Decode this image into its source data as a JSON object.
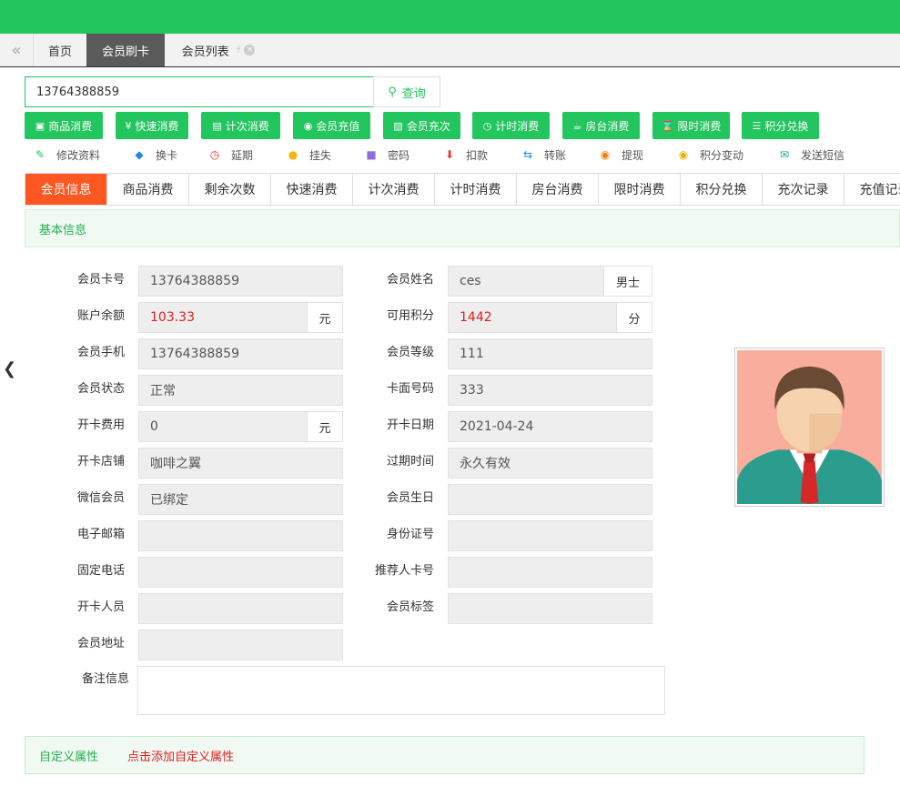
{
  "tabs": [
    {
      "label": "首页"
    },
    {
      "label": "会员刷卡"
    },
    {
      "label": "会员列表"
    }
  ],
  "search": {
    "value": "13764388859",
    "button_label": "查询"
  },
  "actions": [
    {
      "label": "商品消费",
      "icon": "bag-icon"
    },
    {
      "label": "快速消费",
      "icon": "yen-icon"
    },
    {
      "label": "计次消费",
      "icon": "card-icon"
    },
    {
      "label": "会员充值",
      "icon": "coin-icon"
    },
    {
      "label": "会员充次",
      "icon": "inbox-icon"
    },
    {
      "label": "计时消费",
      "icon": "clock-icon"
    },
    {
      "label": "房台消费",
      "icon": "cup-icon"
    },
    {
      "label": "限时消费",
      "icon": "hourglass-icon"
    },
    {
      "label": "积分兑换",
      "icon": "database-icon"
    }
  ],
  "tools": [
    {
      "label": "修改资料",
      "icon": "edit-icon",
      "color": "#22c55e"
    },
    {
      "label": "换卡",
      "icon": "tag-icon",
      "color": "#1e88e5"
    },
    {
      "label": "延期",
      "icon": "clock-icon",
      "color": "#e53935"
    },
    {
      "label": "挂失",
      "icon": "warning-icon",
      "color": "#f5b50a"
    },
    {
      "label": "密码",
      "icon": "lock-icon",
      "color": "#8e6fd6"
    },
    {
      "label": "扣款",
      "icon": "down-arrow-icon",
      "color": "#e53935"
    },
    {
      "label": "转账",
      "icon": "transfer-icon",
      "color": "#1e88e5"
    },
    {
      "label": "提现",
      "icon": "yen-circle-icon",
      "color": "#f57c00"
    },
    {
      "label": "积分变动",
      "icon": "coins-icon",
      "color": "#e8b100"
    },
    {
      "label": "发送短信",
      "icon": "message-icon",
      "color": "#26a69a"
    }
  ],
  "subtabs": [
    "会员信息",
    "商品消费",
    "剩余次数",
    "快速消费",
    "计次消费",
    "计时消费",
    "房台消费",
    "限时消费",
    "积分兑换",
    "充次记录",
    "充值记录"
  ],
  "section_title": "基本信息",
  "fields": {
    "card_no": {
      "label": "会员卡号",
      "value": "13764388859"
    },
    "name": {
      "label": "会员姓名",
      "value": "ces",
      "suffix": "男士"
    },
    "balance": {
      "label": "账户余额",
      "value": "103.33",
      "suffix": "元"
    },
    "points": {
      "label": "可用积分",
      "value": "1442",
      "suffix": "分"
    },
    "phone": {
      "label": "会员手机",
      "value": "13764388859"
    },
    "level": {
      "label": "会员等级",
      "value": "111"
    },
    "status": {
      "label": "会员状态",
      "value": "正常"
    },
    "face_no": {
      "label": "卡面号码",
      "value": "333"
    },
    "fee": {
      "label": "开卡费用",
      "value": "0",
      "suffix": "元"
    },
    "open_date": {
      "label": "开卡日期",
      "value": "2021-04-24"
    },
    "store": {
      "label": "开卡店铺",
      "value": "咖啡之翼"
    },
    "expire": {
      "label": "过期时间",
      "value": "永久有效"
    },
    "wechat": {
      "label": "微信会员",
      "value": "已绑定"
    },
    "birthday": {
      "label": "会员生日",
      "value": ""
    },
    "email": {
      "label": "电子邮箱",
      "value": ""
    },
    "id_card": {
      "label": "身份证号",
      "value": ""
    },
    "tel": {
      "label": "固定电话",
      "value": ""
    },
    "referrer": {
      "label": "推荐人卡号",
      "value": ""
    },
    "opener": {
      "label": "开卡人员",
      "value": ""
    },
    "tags": {
      "label": "会员标签",
      "value": ""
    },
    "address": {
      "label": "会员地址",
      "value": ""
    },
    "remark": {
      "label": "备注信息",
      "value": ""
    }
  },
  "custom": {
    "title": "自定义属性",
    "link": "点击添加自定义属性"
  },
  "colors": {
    "brand": "#22c55e",
    "active_tab": "#ff5722",
    "value_red": "#e02020"
  }
}
